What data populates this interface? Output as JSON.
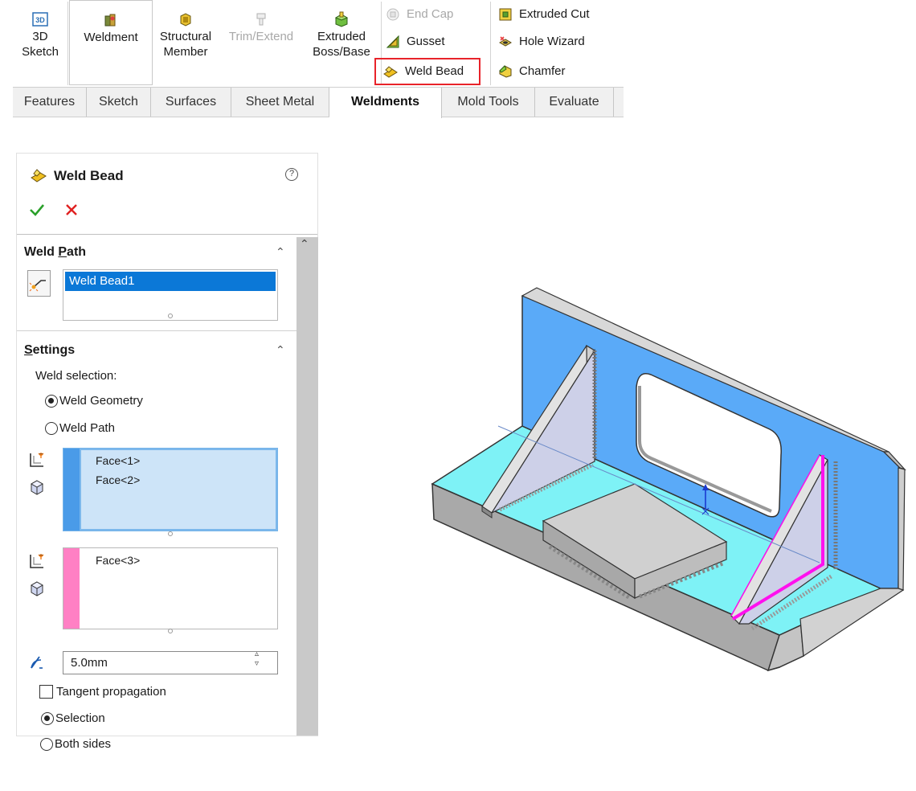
{
  "ribbon": {
    "sketch3d": {
      "icon_text": "3D",
      "line1": "3D",
      "line2": "Sketch"
    },
    "weldment": {
      "label": "Weldment"
    },
    "structural_member": {
      "line1": "Structural",
      "line2": "Member"
    },
    "trim_extend": {
      "label": "Trim/Extend"
    },
    "extruded_boss": {
      "line1": "Extruded",
      "line2": "Boss/Base"
    },
    "end_cap": {
      "label": "End Cap"
    },
    "gusset": {
      "label": "Gusset"
    },
    "weld_bead": {
      "label": "Weld Bead"
    },
    "extruded_cut": {
      "label": "Extruded Cut"
    },
    "hole_wizard": {
      "label": "Hole Wizard"
    },
    "chamfer": {
      "label": "Chamfer"
    },
    "tabs": [
      "Features",
      "Sketch",
      "Surfaces",
      "Sheet Metal",
      "Weldments",
      "Mold Tools",
      "Evaluate"
    ],
    "active_tab": "Weldments"
  },
  "property_manager": {
    "title": "Weld Bead",
    "help_glyph": "?",
    "weld_path": {
      "title_prefix": "Weld ",
      "title_underlined": "P",
      "title_suffix": "ath",
      "selected_item": "Weld Bead1"
    },
    "settings": {
      "title_underlined": "S",
      "title_suffix": "ettings",
      "weld_selection_label": "Weld selection:",
      "options": [
        "Weld Geometry",
        "Weld Path"
      ],
      "selected_option": "Weld Geometry",
      "set1_items": [
        "Face<1>",
        "Face<2>"
      ],
      "set2_items": [
        "Face<3>"
      ],
      "set1_color": "#4a9be8",
      "set2_color": "#ff80c4",
      "bead_size": "5.0mm",
      "tangent_prefix": "Tan",
      "tangent_underlined": "g",
      "tangent_suffix": "ent propagation",
      "tangent_checked": false,
      "side_options": [
        "Selection",
        "Both sides"
      ],
      "selected_side": "Selection"
    }
  },
  "colors": {
    "vertical_plate": "#5aaaf8",
    "base_plate": "#7ef2f6",
    "gusset": "#cdd0e8",
    "weld_path_highlight": "#ff10ee",
    "ribbon_highlight": "#e8232a"
  }
}
